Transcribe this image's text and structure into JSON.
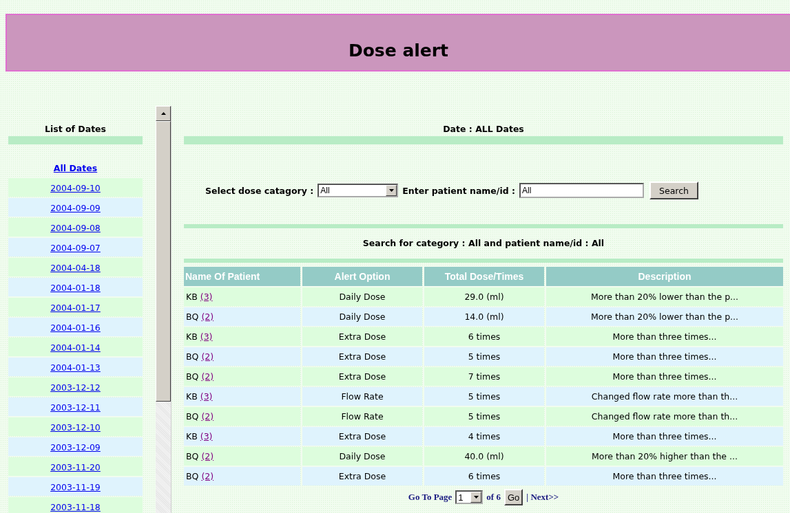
{
  "header": {
    "title": "Dose alert"
  },
  "sidebar": {
    "title": "List of Dates",
    "all_link": "All Dates",
    "dates": [
      "2004-09-10",
      "2004-09-09",
      "2004-09-08",
      "2004-09-07",
      "2004-04-18",
      "2004-01-18",
      "2004-01-17",
      "2004-01-16",
      "2004-01-14",
      "2004-01-13",
      "2003-12-12",
      "2003-12-11",
      "2003-12-10",
      "2003-12-09",
      "2003-11-20",
      "2003-11-19",
      "2003-11-18"
    ]
  },
  "main": {
    "date_heading": "Date : ALL Dates",
    "filter": {
      "category_label": "Select dose catagory :",
      "category_value": "All",
      "patient_label": "Enter patient name/id :",
      "patient_value": "All",
      "search_button": "Search"
    },
    "search_summary": "Search for category : All and patient name/id : All",
    "table": {
      "columns": [
        "Name Of Patient",
        "Alert Option",
        "Total Dose/Times",
        "Description"
      ],
      "rows": [
        {
          "patient": "KB",
          "count": "(3)",
          "alert": "Daily Dose",
          "total": "29.0 (ml)",
          "description": "More than 20% lower than the p..."
        },
        {
          "patient": "BQ",
          "count": "(2)",
          "alert": "Daily Dose",
          "total": "14.0 (ml)",
          "description": "More than 20% lower than the p..."
        },
        {
          "patient": "KB",
          "count": "(3)",
          "alert": "Extra Dose",
          "total": "6 times",
          "description": "More than three times..."
        },
        {
          "patient": "BQ",
          "count": "(2)",
          "alert": "Extra Dose",
          "total": "5 times",
          "description": "More than three times..."
        },
        {
          "patient": "BQ",
          "count": "(2)",
          "alert": "Extra Dose",
          "total": "7 times",
          "description": "More than three times..."
        },
        {
          "patient": "KB",
          "count": "(3)",
          "alert": "Flow Rate",
          "total": "5 times",
          "description": "Changed flow rate more than th..."
        },
        {
          "patient": "BQ",
          "count": "(2)",
          "alert": "Flow Rate",
          "total": "5 times",
          "description": "Changed flow rate more than th..."
        },
        {
          "patient": "KB",
          "count": "(3)",
          "alert": "Extra Dose",
          "total": "4 times",
          "description": "More than three times..."
        },
        {
          "patient": "BQ",
          "count": "(2)",
          "alert": "Daily Dose",
          "total": "40.0 (ml)",
          "description": "More than 20% higher than the ..."
        },
        {
          "patient": "BQ",
          "count": "(2)",
          "alert": "Extra Dose",
          "total": "6 times",
          "description": "More than three times..."
        }
      ]
    },
    "pagination": {
      "label": "Go To Page",
      "page": "1",
      "of_label": "of",
      "total": "6",
      "go_button": "Go",
      "next_link": "| Next>>"
    }
  }
}
